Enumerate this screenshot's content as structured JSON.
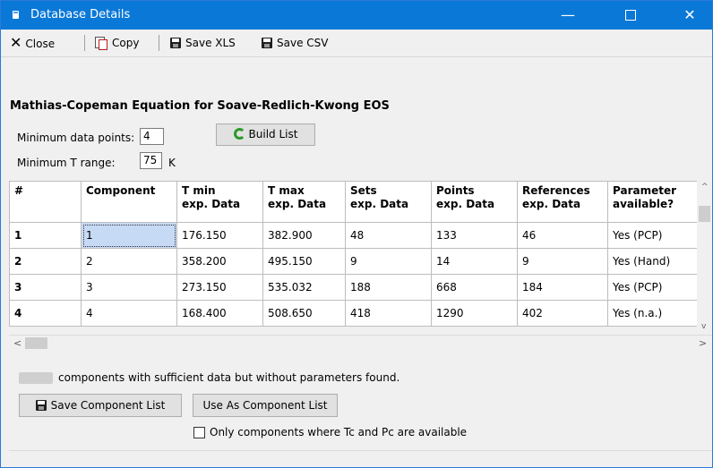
{
  "window": {
    "title": "Database Details",
    "min_glyph": "—",
    "close_glyph": "✕"
  },
  "toolbar": {
    "close_label": "Close",
    "close_glyph": "✕",
    "copy_label": "Copy",
    "save_xls_label": "Save XLS",
    "save_csv_label": "Save CSV"
  },
  "heading": "Mathias-Copeman Equation for Soave-Redlich-Kwong EOS",
  "form": {
    "min_points_label": "Minimum data points:",
    "min_points_value": "4",
    "min_range_label": "Minimum T range:",
    "min_range_value": "75",
    "min_range_unit": "K",
    "build_list_label": "Build List"
  },
  "table": {
    "headers": [
      {
        "l1": "#",
        "l2": ""
      },
      {
        "l1": "Component",
        "l2": ""
      },
      {
        "l1": "T min",
        "l2": "exp. Data"
      },
      {
        "l1": "T max",
        "l2": "exp. Data"
      },
      {
        "l1": "Sets",
        "l2": "exp. Data"
      },
      {
        "l1": "Points",
        "l2": "exp. Data"
      },
      {
        "l1": "References",
        "l2": "exp. Data"
      },
      {
        "l1": "Parameter",
        "l2": "available?"
      }
    ],
    "rows": [
      [
        "1",
        "1",
        "176.150",
        "382.900",
        "48",
        "133",
        "46",
        "Yes (PCP)"
      ],
      [
        "2",
        "2",
        "358.200",
        "495.150",
        "9",
        "14",
        "9",
        "Yes (Hand)"
      ],
      [
        "3",
        "3",
        "273.150",
        "535.032",
        "188",
        "668",
        "184",
        "Yes (PCP)"
      ],
      [
        "4",
        "4",
        "168.400",
        "508.650",
        "418",
        "1290",
        "402",
        "Yes (n.a.)"
      ]
    ]
  },
  "scroll": {
    "up": "^",
    "down": "v",
    "left": "<",
    "right": ">"
  },
  "footer": {
    "info_text": "components with sufficient data but without parameters found.",
    "save_list_label": "Save Component List",
    "use_as_label": "Use As Component List",
    "only_tc_pc_label": "Only components where Tc and Pc are available"
  }
}
